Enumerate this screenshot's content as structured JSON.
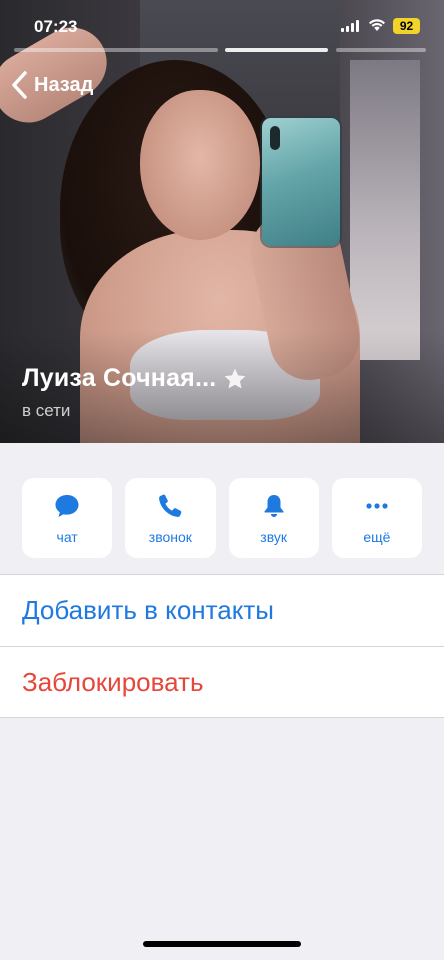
{
  "status_bar": {
    "time": "07:23",
    "battery": "92",
    "battery_color": "#f2d32a"
  },
  "nav": {
    "back_label": "Назад"
  },
  "profile": {
    "name": "Луиза Сочная...",
    "presence": "в сети",
    "photo_icon": "profile-photo"
  },
  "actions": [
    {
      "label": "чат",
      "icon": "chat-bubble-icon"
    },
    {
      "label": "звонок",
      "icon": "phone-icon"
    },
    {
      "label": "звук",
      "icon": "bell-icon"
    },
    {
      "label": "ещё",
      "icon": "more-dots-icon"
    }
  ],
  "list": {
    "add_contact": "Добавить в контакты",
    "block": "Заблокировать"
  },
  "colors": {
    "accent": "#1f7ae0",
    "destructive": "#e5473b",
    "background": "#efeff4"
  }
}
